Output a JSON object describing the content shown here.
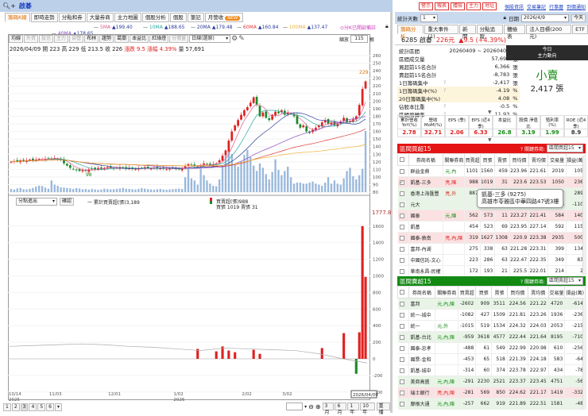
{
  "window": {
    "title": "啟碁",
    "search_icon": "search-plus-icon"
  },
  "left_tabs": [
    {
      "label": "籌碼K線",
      "active": true
    },
    {
      "label": "即時走勢"
    },
    {
      "label": "分點和券"
    },
    {
      "label": "大量券商"
    },
    {
      "label": "主力地圖"
    },
    {
      "label": "個股分析"
    },
    {
      "label": "個股"
    },
    {
      "label": "筆記"
    },
    {
      "label": "月營收",
      "badge": "NEW"
    }
  ],
  "ma_legend": [
    {
      "name": "5MA",
      "value": "▲199.40",
      "color": "#e05a8a"
    },
    {
      "name": "10MA",
      "value": "▲188.65",
      "color": "#2aa8a0"
    },
    {
      "name": "20MA",
      "value": "▲179.48",
      "color": "#2a3a9a"
    },
    {
      "name": "60MA",
      "value": "▲160.84",
      "color": "#e03a3a"
    },
    {
      "name": "100MA",
      "value": "▲137.47",
      "color": "#f0b030"
    },
    {
      "name": "40MA",
      "value": "▲178.65",
      "color": "#8a4ac0"
    }
  ],
  "alert_link": "⊙分K已開啟備註",
  "toolbar": {
    "buttons": [
      "均線",
      "外資",
      "投信",
      "主力",
      "自營",
      "布林",
      "趨勢",
      "葛蘭",
      "本益比",
      "紅綠燈",
      "分價量"
    ],
    "disabled": [
      1,
      2,
      3,
      4,
      10
    ],
    "period_select": "日線(還原)",
    "zoom_label": "縮放",
    "zoom_value": "115",
    "zoom_unit": "根"
  },
  "info_line": {
    "date": "2026/04/09",
    "open": "開 223",
    "high": "高 229",
    "low": "低 213.5",
    "close": "收 226",
    "change": "漲跌 9.5",
    "pct": "漲幅 4.39%",
    "volume": "量 57,691"
  },
  "lower_panel": {
    "select": "分點進出",
    "confirm": "確認",
    "cum_label": "一 累計買賣超(張)3,189",
    "net_label": "買賣超(張)988",
    "buysell_label": "買張 1019 賣張 31",
    "max_label": "1777.8"
  },
  "footer": {
    "pages": [
      "1",
      "2",
      "3",
      "4",
      "5",
      "6"
    ],
    "ranges": [
      "3月",
      "6月",
      "1年",
      "10年"
    ],
    "replay": "重播"
  },
  "colors": {
    "up": "#e02020",
    "down": "#1a8a2a",
    "volume": "#9ab8dc",
    "accent_red": "#e02020",
    "accent_green": "#138a13"
  },
  "chart_data": {
    "type": "candlestick",
    "price_axis": [
      260,
      250,
      240,
      230,
      220,
      210,
      200,
      190,
      180,
      170,
      160,
      150,
      140,
      130,
      120,
      110,
      100,
      90,
      80
    ],
    "ylim": [
      80,
      260
    ],
    "netbuy_axis": [
      1600,
      1400,
      1200,
      1000,
      800,
      600,
      400,
      200,
      0,
      -200,
      -400
    ],
    "netbuy_ylim": [
      -400,
      1777.8
    ],
    "x_ticks": [
      {
        "i": 0,
        "label": "10/14",
        "sub": "2025"
      },
      {
        "i": 13,
        "label": "11/03"
      },
      {
        "i": 32,
        "label": "12/01"
      },
      {
        "i": 53,
        "label": "1/02",
        "sub": "2026"
      },
      {
        "i": 75,
        "label": "2/02"
      },
      {
        "i": 88,
        "label": "3/02"
      },
      {
        "i": 111,
        "label": "4/"
      }
    ],
    "last_date_label": "2026/04/09",
    "high_marker": "229",
    "low_marker": "98",
    "closes": [
      120,
      121,
      120,
      122,
      121,
      122,
      123,
      122,
      123,
      124,
      123,
      124,
      125,
      124,
      125,
      124,
      122,
      118,
      115,
      112,
      110,
      109,
      108,
      109,
      108,
      110,
      111,
      110,
      112,
      111,
      112,
      113,
      112,
      111,
      112,
      113,
      112,
      111,
      112,
      111,
      110,
      111,
      112,
      113,
      112,
      111,
      112,
      111,
      112,
      111,
      110,
      111,
      112,
      111,
      110,
      111,
      114,
      117,
      116,
      115,
      114,
      115,
      118,
      117,
      116,
      117,
      118,
      122,
      128,
      135,
      148,
      160,
      168,
      175,
      182,
      188,
      192,
      198,
      205,
      195,
      180,
      185,
      178,
      175,
      182,
      186,
      184,
      188,
      182,
      185,
      183,
      180,
      170,
      165,
      168,
      160,
      158,
      162,
      165,
      168,
      172,
      175,
      170,
      172,
      168,
      170,
      173,
      178,
      172,
      174,
      176,
      180,
      195,
      216,
      226
    ],
    "volumes": [
      3000,
      2500,
      3500,
      4000,
      2800,
      2600,
      3100,
      3900,
      5200,
      6100,
      5800,
      4300,
      3200,
      11000,
      7000,
      6000,
      4500,
      4300,
      3900,
      3600,
      3000,
      3800,
      3400,
      2700,
      2900,
      2400,
      3100,
      2600,
      2200,
      2500,
      3300,
      2900,
      2600,
      2800,
      3100,
      3400,
      3900,
      3200,
      3000,
      2700,
      2500,
      3100,
      3800,
      3300,
      2800,
      2600,
      2400,
      2700,
      3000,
      2500,
      2300,
      2600,
      2800,
      3100,
      3300,
      3000,
      14000,
      22000,
      13000,
      11000,
      7000,
      22000,
      16000,
      11000,
      8000,
      6000,
      5500,
      12000,
      25000,
      34000,
      40000,
      36000,
      26000,
      24000,
      29000,
      35000,
      40000,
      33000,
      25000,
      20000,
      27000,
      23000,
      17000,
      12000,
      19000,
      31000,
      21000,
      16000,
      20000,
      24000,
      14000,
      8000,
      9000,
      9000,
      8000,
      8000,
      9000,
      10000,
      8000,
      7000,
      6000,
      9000,
      14000,
      8000,
      11000,
      8000,
      7000,
      13000,
      20000,
      23000,
      15000,
      12000,
      16000,
      22000,
      57691
    ],
    "netbuy_bars": [
      {
        "i": 60,
        "v": 120
      },
      {
        "i": 66,
        "v": 90
      },
      {
        "i": 68,
        "v": 150
      },
      {
        "i": 70,
        "v": 100
      },
      {
        "i": 72,
        "v": 80
      },
      {
        "i": 78,
        "v": 110
      },
      {
        "i": 80,
        "v": 60
      },
      {
        "i": 100,
        "v": 130
      },
      {
        "i": 107,
        "v": 310
      },
      {
        "i": 111,
        "v": -180
      },
      {
        "i": 112,
        "v": 320
      },
      {
        "i": 113,
        "v": 1600
      },
      {
        "i": 114,
        "v": 988
      }
    ],
    "cum_line": [
      150,
      160,
      170,
      180,
      170,
      150,
      140,
      120,
      100,
      130,
      120,
      110,
      100,
      60,
      0,
      -50
    ]
  },
  "right": {
    "top_buttons": [
      "警示",
      "報表",
      "體檢",
      "主力",
      "地址"
    ],
    "links": [
      "個股資訊",
      "交易筆記",
      "行事曆",
      "到價通知"
    ],
    "days_label": "統計天數",
    "days_value": "1",
    "date_label": "日期",
    "date_value": "2026/4/9",
    "today": "今天",
    "tabs": [
      "籌碼分析",
      "重大事件(1)",
      "新聞",
      "分點追蹤",
      "體檢表",
      "法人目標(200元)",
      "ETF"
    ],
    "stock": {
      "code_name": "6285 啟碁",
      "price": "226元",
      "change": "▲9.5 (+4.39%)"
    },
    "stats": [
      [
        "統計區間",
        "",
        "20260409 ~ 20260409",
        ""
      ],
      [
        "區間成交量",
        "",
        "57,691",
        "張"
      ],
      [
        "買超前15名合計",
        "",
        "6,366",
        "張"
      ],
      [
        "賣超前15名合計",
        "",
        "-8,783",
        "張"
      ],
      [
        "1日籌碼集中",
        "?",
        "-2,417",
        "張"
      ],
      [
        "1日籌碼集中(%)",
        "?",
        "-4.19",
        "%"
      ],
      [
        "20日籌碼集中(%)",
        "",
        "4.08",
        "%"
      ],
      [
        "佔股本比重",
        "?",
        "-0.5",
        "%"
      ],
      [
        "區間周轉率",
        "?",
        "11.93",
        "%"
      ]
    ],
    "today_box": {
      "line1": "今日",
      "line2": "主力動向",
      "verdict": "小賣",
      "amount": "2,417 張"
    },
    "metrics": [
      {
        "h": "累計營收 YoY(%)",
        "v": "2.78",
        "c": "#e02020"
      },
      {
        "h": "營收 MoM(%)",
        "v": "32.71",
        "c": "#e02020"
      },
      {
        "h": "EPS (季)",
        "v": "2.06",
        "c": "#e02020"
      },
      {
        "h": "EPS (近4季)",
        "v": "6.33",
        "c": "#e02020"
      },
      {
        "h": "本益比",
        "v": "26.8",
        "c": "#138a13"
      },
      {
        "h": "股價 淨值比",
        "v": "3.19",
        "c": "#138a13"
      },
      {
        "h": "殖利率 (%)",
        "v": "1.99",
        "c": "#138a13"
      },
      {
        "h": "ROE (近4季)",
        "v": "8.9",
        "c": "#333"
      }
    ],
    "columns": [
      "券商名稱",
      "關聯券商",
      "買賣超",
      "買張",
      "賣張",
      "買均價",
      "賣均價",
      "交易量",
      "損益(萬)"
    ],
    "buy_table": {
      "title": "區間買超15",
      "key_label": "? 關鍵券商:",
      "key_select": "區間買超15",
      "rows": [
        {
          "c": "",
          "name": "群益金鼎",
          "rel": "元,內",
          "rc": "g",
          "d": [
            "1101",
            "1560",
            "459",
            "223.96",
            "221.61",
            "2019",
            "105"
          ]
        },
        {
          "c": "p",
          "name": "凱基-三多",
          "rel": "亮,陳",
          "rc": "r",
          "checked": true,
          "d": [
            "988",
            "1019",
            "31",
            "223.6",
            "223.53",
            "1050",
            "236"
          ]
        },
        {
          "c": "g",
          "name": "香港上海匯豐",
          "rel": "亮,外",
          "rc": "r",
          "d": [
            "887",
            "887",
            "0",
            "223.01",
            "--",
            "887",
            "289"
          ]
        },
        {
          "c": "g",
          "name": "元大",
          "rel": "",
          "rc": "",
          "d": [
            "",
            "",
            "4315",
            "223.27",
            "222.8",
            "11305",
            "-110"
          ]
        },
        {
          "c": "p",
          "name": "國泰",
          "rel": "元,陳",
          "rc": "g",
          "d": [
            "562",
            "573",
            "11",
            "223.27",
            "221.41",
            "584",
            "140"
          ]
        },
        {
          "c": "",
          "name": "凱基",
          "rel": "",
          "rc": "",
          "d": [
            "454",
            "523",
            "69",
            "223.95",
            "227.14",
            "592",
            "115"
          ]
        },
        {
          "c": "p",
          "name": "國泰-敦南",
          "rel": "亮,內,陳",
          "rc": "r",
          "d": [
            "319",
            "1627",
            "1308",
            "220.9",
            "223.38",
            "2935",
            "500"
          ]
        },
        {
          "c": "",
          "name": "富邦-內湖",
          "rel": "",
          "rc": "",
          "d": [
            "275",
            "338",
            "63",
            "221.28",
            "223.31",
            "399",
            "134"
          ]
        },
        {
          "c": "",
          "name": "中國信託-文心",
          "rel": "",
          "rc": "",
          "d": [
            "223",
            "286",
            "63",
            "222.47",
            "222.35",
            "349",
            "83"
          ]
        },
        {
          "c": "",
          "name": "華南永昌-民權",
          "rel": "",
          "rc": "",
          "d": [
            "172",
            "193",
            "21",
            "225.5",
            "222.01",
            "214",
            "2"
          ]
        }
      ]
    },
    "tooltip": {
      "line1": "凱基-三多 (9275)",
      "line2": "高雄市苓雅區中華四路47號3樓"
    },
    "sell_table": {
      "title": "區間賣超15",
      "key_label": "? 關鍵券商:",
      "key_select": "區間賣超15",
      "rows": [
        {
          "c": "g",
          "name": "富邦",
          "rel": "元,內,陳",
          "rc": "g",
          "d": [
            "-2602",
            "909",
            "3511",
            "224.56",
            "221.22",
            "4720",
            "-614"
          ]
        },
        {
          "c": "",
          "name": "統一-城中",
          "rel": "",
          "rc": "",
          "d": [
            "-1082",
            "427",
            "1509",
            "221.81",
            "223.26",
            "1936",
            "-236"
          ]
        },
        {
          "c": "",
          "name": "統一",
          "rel": "元,外",
          "rc": "g",
          "d": [
            "-1015",
            "519",
            "1534",
            "224.32",
            "224.03",
            "2053",
            "-215"
          ]
        },
        {
          "c": "g",
          "name": "凱基-台北",
          "rel": "元,內,陳",
          "rc": "g",
          "d": [
            "-959",
            "3618",
            "4577",
            "222.44",
            "221.64",
            "8195",
            "-710"
          ]
        },
        {
          "c": "",
          "name": "國泰-忠孝",
          "rel": "",
          "rc": "",
          "d": [
            "-488",
            "61",
            "549",
            "222.99",
            "220.98",
            "610",
            "-256"
          ]
        },
        {
          "c": "",
          "name": "國票-金和",
          "rel": "",
          "rc": "",
          "d": [
            "-453",
            "65",
            "518",
            "221.39",
            "224.18",
            "583",
            "-64"
          ]
        },
        {
          "c": "",
          "name": "凱基-城中",
          "rel": "",
          "rc": "",
          "d": [
            "-314",
            "60",
            "374",
            "223.78",
            "222.97",
            "434",
            "-78"
          ]
        },
        {
          "c": "g",
          "name": "美商高盛",
          "rel": "元,內,陳",
          "rc": "g",
          "d": [
            "-291",
            "2230",
            "2521",
            "223.37",
            "223.45",
            "4751",
            "-56"
          ]
        },
        {
          "c": "p",
          "name": "瑞士銀行",
          "rel": "亮,內,陳",
          "rc": "r",
          "d": [
            "-281",
            "569",
            "850",
            "224.62",
            "221.17",
            "1419",
            "-332"
          ]
        },
        {
          "c": "g",
          "name": "摩根大通",
          "rel": "元,內,陳",
          "rc": "g",
          "d": [
            "-257",
            "662",
            "919",
            "221.89",
            "222.51",
            "1581",
            "-48"
          ]
        }
      ]
    }
  }
}
